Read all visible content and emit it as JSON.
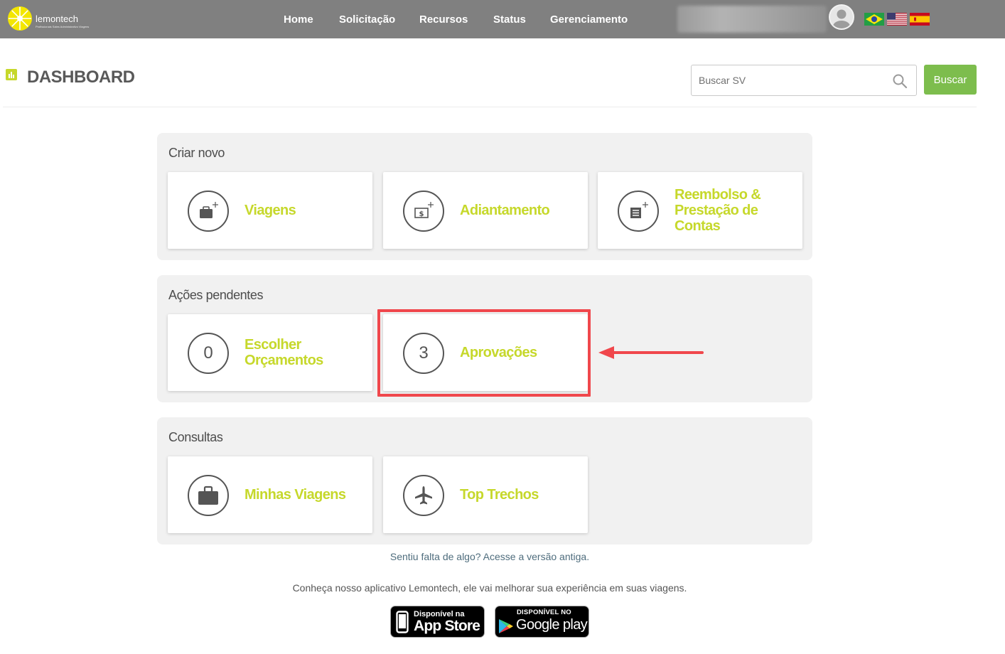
{
  "brand": {
    "name": "lemontech",
    "tagline": "Profissionais Sales Administrativo Viagens",
    "accent": "#c6d82b"
  },
  "nav": {
    "items": [
      "Home",
      "Solicitação",
      "Recursos",
      "Status",
      "Gerenciamento"
    ]
  },
  "user": {
    "avatar_icon": "user-icon",
    "name_redacted": true
  },
  "languages": [
    "pt-BR",
    "en-US",
    "es-ES"
  ],
  "header": {
    "title": "DASHBOARD",
    "icon": "bar-chart-icon"
  },
  "search": {
    "placeholder": "Buscar SV",
    "value": "",
    "button_label": "Buscar",
    "button_color": "#7dbd4d"
  },
  "sections": {
    "criar": {
      "title": "Criar novo",
      "cards": [
        {
          "label": "Viagens",
          "icon": "briefcase-plus-icon"
        },
        {
          "label": "Adiantamento",
          "icon": "money-plus-icon"
        },
        {
          "label": "Reembolso & Prestação de Contas",
          "icon": "receipt-plus-icon"
        }
      ]
    },
    "pendentes": {
      "title": "Ações pendentes",
      "cards": [
        {
          "label": "Escolher Orçamentos",
          "count": "0"
        },
        {
          "label": "Aprovações",
          "count": "3"
        }
      ]
    },
    "consultas": {
      "title": "Consultas",
      "cards": [
        {
          "label": "Minhas Viagens",
          "icon": "briefcase-icon"
        },
        {
          "label": "Top Trechos",
          "icon": "airplane-icon"
        }
      ]
    }
  },
  "footer": {
    "old_version_link": "Sentiu falta de algo? Acesse a versão antiga.",
    "app_promo": "Conheça nosso aplicativo Lemontech, ele vai melhorar sua experiência em suas viagens.",
    "app_store": {
      "small": "Disponível na",
      "big": "App Store"
    },
    "google_play": {
      "small": "DISPONÍVEL NO",
      "big": "Google play"
    }
  },
  "annotation": {
    "highlight_color": "#f0474c"
  }
}
